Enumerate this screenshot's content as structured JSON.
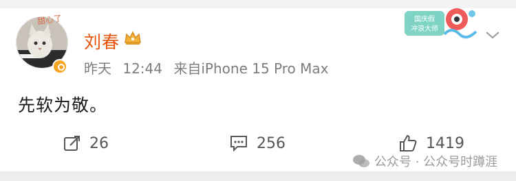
{
  "post": {
    "author": {
      "name": "刘春",
      "avatar_caption": "甜心了"
    },
    "meta": {
      "date": "昨天",
      "time": "12:44",
      "source": "来自iPhone 15 Pro Max"
    },
    "text": "先软为敬。",
    "badge_text": [
      "国庆假",
      "冲浪大师"
    ]
  },
  "actions": {
    "repost": {
      "icon": "repost-icon",
      "count": "26"
    },
    "comment": {
      "icon": "comment-icon",
      "count": "256"
    },
    "like": {
      "icon": "thumbs-up-icon",
      "count": "1419"
    }
  },
  "watermark": {
    "text": "公众号 · 公众号时蹲涯"
  },
  "colors": {
    "name": "#e8540c",
    "meta": "#7c7c7c",
    "background": "#f2f2f2",
    "card": "#ffffff"
  }
}
